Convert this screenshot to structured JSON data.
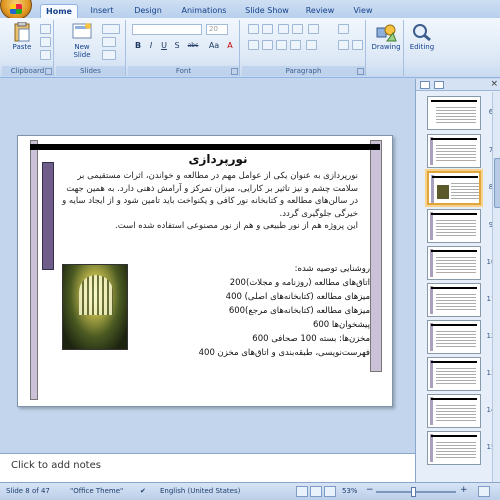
{
  "app": {
    "name": "PowerPoint"
  },
  "tabs": [
    {
      "label": "Home",
      "active": true
    },
    {
      "label": "Insert"
    },
    {
      "label": "Design"
    },
    {
      "label": "Animations"
    },
    {
      "label": "Slide Show"
    },
    {
      "label": "Review"
    },
    {
      "label": "View"
    }
  ],
  "ribbon": {
    "clipboard": {
      "label": "Clipboard",
      "paste": "Paste"
    },
    "slides": {
      "label": "Slides",
      "new_slide_line1": "New",
      "new_slide_line2": "Slide"
    },
    "font": {
      "label": "Font",
      "font_size": "20",
      "bold": "B",
      "italic": "I",
      "underline": "U",
      "shadow": "S",
      "strike": "abc",
      "aa": "Aa",
      "a": "A"
    },
    "paragraph": {
      "label": "Paragraph"
    },
    "drawing": {
      "label": "Drawing"
    },
    "editing": {
      "label": "Editing"
    }
  },
  "slide": {
    "title": "نورپردازی",
    "paragraph": "نورپردازی به عنوان یکی از عوامل مهم در مطالعه و خواندن، اثرات مستقیمی بر سلامت چشم و نیز تاثیر بر کارایی، میزان تمرکز و آرامش ذهنی دارد. به همین جهت در سالن‌های مطالعه و کتابخانه نور کافی و یکنواخت باید تامین شود و از ایجاد سایه و خیرگی جلوگیری گردد.",
    "paragraph2": "این پروژه هم از نور طبیعی و هم از نور مصنوعی استفاده شده است.",
    "list": [
      "روشنایی توصیه شده:",
      "اتاق‌های مطالعه (روزنامه و مجلات)200",
      "میزهای مطالعه (کتابخانه‌های اصلی) 400",
      "میزهای مطالعه (کتابخانه‌های مرجع)600",
      "پیشخوان‌ها 600",
      "مخزن‌ها: بسته 100   صحافی 600",
      "فهرست‌نویسی، طبقه‌بندی و اتاق‌های مخزن 400"
    ]
  },
  "notes": {
    "placeholder": "Click to add notes"
  },
  "thumbnails": [
    {
      "num": "6"
    },
    {
      "num": "7"
    },
    {
      "num": "8",
      "selected": true
    },
    {
      "num": "9"
    },
    {
      "num": "10"
    },
    {
      "num": "11"
    },
    {
      "num": "12"
    },
    {
      "num": "13"
    },
    {
      "num": "14"
    },
    {
      "num": "15"
    }
  ],
  "status": {
    "slide": "Slide 8 of 47",
    "theme": "\"Office Theme\"",
    "language": "English (United States)",
    "zoom": "53%"
  },
  "colors": {
    "selected_thumb": "#e0a53c",
    "ribbon_blue": "#15428b"
  }
}
